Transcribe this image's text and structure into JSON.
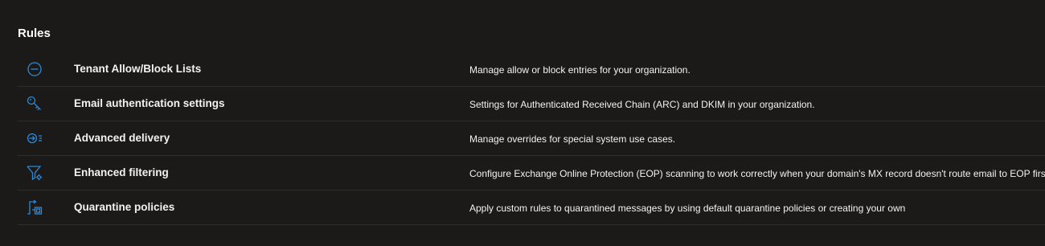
{
  "section": {
    "title": "Rules"
  },
  "colors": {
    "background": "#1b1a19",
    "icon_accent": "#2b88d8",
    "divider": "#2f2e2d",
    "text": "#f3f2f1"
  },
  "rules": [
    {
      "icon": "block-icon",
      "name": "Tenant Allow/Block Lists",
      "description": "Manage allow or block entries for your organization."
    },
    {
      "icon": "key-icon",
      "name": "Email authentication settings",
      "description": "Settings for Authenticated Received Chain (ARC) and DKIM in your organization."
    },
    {
      "icon": "advanced-delivery-icon",
      "name": "Advanced delivery",
      "description": "Manage overrides for special system use cases."
    },
    {
      "icon": "filter-settings-icon",
      "name": "Enhanced filtering",
      "description": "Configure Exchange Online Protection (EOP) scanning to work correctly when your domain's MX record doesn't route email to EOP first."
    },
    {
      "icon": "quarantine-icon",
      "name": "Quarantine policies",
      "description": "Apply custom rules to quarantined messages by using default quarantine policies or creating your own"
    }
  ]
}
